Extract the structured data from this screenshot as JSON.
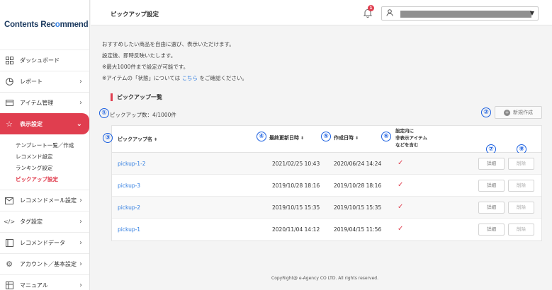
{
  "logo": {
    "part1": "Contents Rec",
    "part2": "o",
    "part3": "mmend"
  },
  "sidebar": {
    "items": [
      {
        "label": "ダッシュボード",
        "icon": "dashboard-icon",
        "has_chevron": false
      },
      {
        "label": "レポート",
        "icon": "report-icon",
        "has_chevron": true
      },
      {
        "label": "アイテム管理",
        "icon": "item-icon",
        "has_chevron": true
      },
      {
        "label": "表示設定",
        "icon": "star-icon",
        "has_chevron": true,
        "active": true
      },
      {
        "label": "レコメンドメール設定",
        "icon": "mail-icon",
        "has_chevron": true
      },
      {
        "label": "タグ設定",
        "icon": "code-icon",
        "has_chevron": true
      },
      {
        "label": "レコメンドデータ",
        "icon": "data-icon",
        "has_chevron": true
      },
      {
        "label": "アカウント／基本設定",
        "icon": "gear-icon",
        "has_chevron": true
      },
      {
        "label": "マニュアル",
        "icon": "manual-icon",
        "has_chevron": true
      }
    ],
    "subitems": [
      {
        "label": "テンプレート一覧／作成"
      },
      {
        "label": "レコメンド設定"
      },
      {
        "label": "ランキング設定"
      },
      {
        "label": "ピックアップ設定",
        "current": true
      }
    ]
  },
  "header": {
    "title": "ピックアップ設定",
    "notification_count": "1"
  },
  "description": {
    "line1": "おすすめしたい商品を自由に選び、表示いただけます。",
    "line2": "設定後、即時反映いたします。",
    "line3": "※最大1000件まで設定が可能です。",
    "line4_pre": "※アイテムの「状態」については",
    "line4_link": "こちら",
    "line4_post": "をご確認ください。"
  },
  "section": {
    "title": "ピックアップ一覧",
    "count": "ピックアップ数：4/1000件",
    "new_button": "新規作成"
  },
  "annotations": [
    "①",
    "②",
    "③",
    "④",
    "⑤",
    "⑥",
    "⑦",
    "⑧"
  ],
  "table": {
    "headers": {
      "name": "ピックアップ名",
      "updated": "最終更新日時",
      "created": "作成日時",
      "hidden_line1": "設定内に",
      "hidden_line2": "非表示アイテム",
      "hidden_line3": "などを含む"
    },
    "detail_label": "詳細",
    "delete_label": "削除",
    "rows": [
      {
        "name": "pickup-1-2",
        "updated": "2021/02/25 10:43",
        "created": "2020/06/24 14:24"
      },
      {
        "name": "pickup-3",
        "updated": "2019/10/28 18:16",
        "created": "2019/10/28 18:16"
      },
      {
        "name": "pickup-2",
        "updated": "2019/10/15 15:35",
        "created": "2019/10/15 15:35"
      },
      {
        "name": "pickup-1",
        "updated": "2020/11/04 14:12",
        "created": "2019/04/15 11:56"
      }
    ]
  },
  "footer": {
    "copyright": "CopyRight@ e-Agency CO LTD. All rights reserved."
  },
  "colors": {
    "accent": "#e03e4f",
    "link": "#2d7be0",
    "annotation": "#1a5fe0"
  }
}
